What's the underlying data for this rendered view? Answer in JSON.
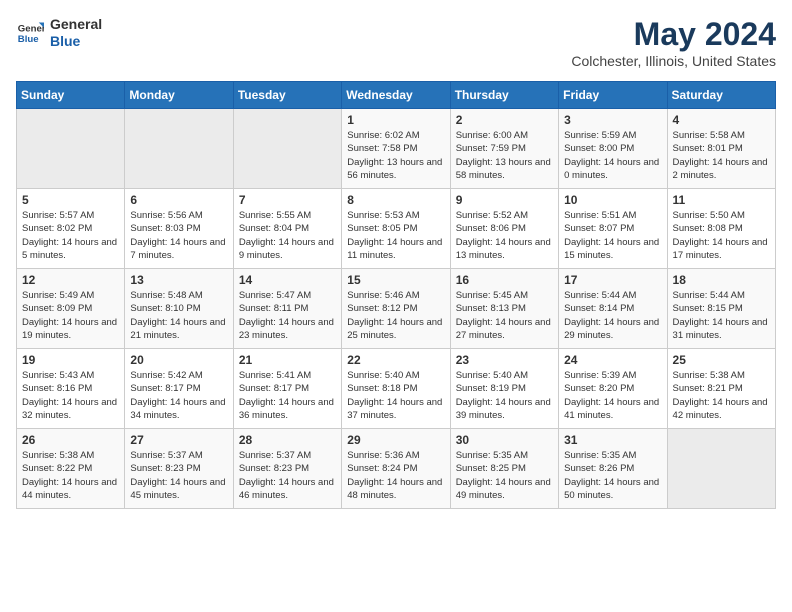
{
  "logo": {
    "general": "General",
    "blue": "Blue"
  },
  "header": {
    "month": "May 2024",
    "location": "Colchester, Illinois, United States"
  },
  "weekdays": [
    "Sunday",
    "Monday",
    "Tuesday",
    "Wednesday",
    "Thursday",
    "Friday",
    "Saturday"
  ],
  "weeks": [
    [
      {
        "day": "",
        "sunrise": "",
        "sunset": "",
        "daylight": ""
      },
      {
        "day": "",
        "sunrise": "",
        "sunset": "",
        "daylight": ""
      },
      {
        "day": "",
        "sunrise": "",
        "sunset": "",
        "daylight": ""
      },
      {
        "day": "1",
        "sunrise": "Sunrise: 6:02 AM",
        "sunset": "Sunset: 7:58 PM",
        "daylight": "Daylight: 13 hours and 56 minutes."
      },
      {
        "day": "2",
        "sunrise": "Sunrise: 6:00 AM",
        "sunset": "Sunset: 7:59 PM",
        "daylight": "Daylight: 13 hours and 58 minutes."
      },
      {
        "day": "3",
        "sunrise": "Sunrise: 5:59 AM",
        "sunset": "Sunset: 8:00 PM",
        "daylight": "Daylight: 14 hours and 0 minutes."
      },
      {
        "day": "4",
        "sunrise": "Sunrise: 5:58 AM",
        "sunset": "Sunset: 8:01 PM",
        "daylight": "Daylight: 14 hours and 2 minutes."
      }
    ],
    [
      {
        "day": "5",
        "sunrise": "Sunrise: 5:57 AM",
        "sunset": "Sunset: 8:02 PM",
        "daylight": "Daylight: 14 hours and 5 minutes."
      },
      {
        "day": "6",
        "sunrise": "Sunrise: 5:56 AM",
        "sunset": "Sunset: 8:03 PM",
        "daylight": "Daylight: 14 hours and 7 minutes."
      },
      {
        "day": "7",
        "sunrise": "Sunrise: 5:55 AM",
        "sunset": "Sunset: 8:04 PM",
        "daylight": "Daylight: 14 hours and 9 minutes."
      },
      {
        "day": "8",
        "sunrise": "Sunrise: 5:53 AM",
        "sunset": "Sunset: 8:05 PM",
        "daylight": "Daylight: 14 hours and 11 minutes."
      },
      {
        "day": "9",
        "sunrise": "Sunrise: 5:52 AM",
        "sunset": "Sunset: 8:06 PM",
        "daylight": "Daylight: 14 hours and 13 minutes."
      },
      {
        "day": "10",
        "sunrise": "Sunrise: 5:51 AM",
        "sunset": "Sunset: 8:07 PM",
        "daylight": "Daylight: 14 hours and 15 minutes."
      },
      {
        "day": "11",
        "sunrise": "Sunrise: 5:50 AM",
        "sunset": "Sunset: 8:08 PM",
        "daylight": "Daylight: 14 hours and 17 minutes."
      }
    ],
    [
      {
        "day": "12",
        "sunrise": "Sunrise: 5:49 AM",
        "sunset": "Sunset: 8:09 PM",
        "daylight": "Daylight: 14 hours and 19 minutes."
      },
      {
        "day": "13",
        "sunrise": "Sunrise: 5:48 AM",
        "sunset": "Sunset: 8:10 PM",
        "daylight": "Daylight: 14 hours and 21 minutes."
      },
      {
        "day": "14",
        "sunrise": "Sunrise: 5:47 AM",
        "sunset": "Sunset: 8:11 PM",
        "daylight": "Daylight: 14 hours and 23 minutes."
      },
      {
        "day": "15",
        "sunrise": "Sunrise: 5:46 AM",
        "sunset": "Sunset: 8:12 PM",
        "daylight": "Daylight: 14 hours and 25 minutes."
      },
      {
        "day": "16",
        "sunrise": "Sunrise: 5:45 AM",
        "sunset": "Sunset: 8:13 PM",
        "daylight": "Daylight: 14 hours and 27 minutes."
      },
      {
        "day": "17",
        "sunrise": "Sunrise: 5:44 AM",
        "sunset": "Sunset: 8:14 PM",
        "daylight": "Daylight: 14 hours and 29 minutes."
      },
      {
        "day": "18",
        "sunrise": "Sunrise: 5:44 AM",
        "sunset": "Sunset: 8:15 PM",
        "daylight": "Daylight: 14 hours and 31 minutes."
      }
    ],
    [
      {
        "day": "19",
        "sunrise": "Sunrise: 5:43 AM",
        "sunset": "Sunset: 8:16 PM",
        "daylight": "Daylight: 14 hours and 32 minutes."
      },
      {
        "day": "20",
        "sunrise": "Sunrise: 5:42 AM",
        "sunset": "Sunset: 8:17 PM",
        "daylight": "Daylight: 14 hours and 34 minutes."
      },
      {
        "day": "21",
        "sunrise": "Sunrise: 5:41 AM",
        "sunset": "Sunset: 8:17 PM",
        "daylight": "Daylight: 14 hours and 36 minutes."
      },
      {
        "day": "22",
        "sunrise": "Sunrise: 5:40 AM",
        "sunset": "Sunset: 8:18 PM",
        "daylight": "Daylight: 14 hours and 37 minutes."
      },
      {
        "day": "23",
        "sunrise": "Sunrise: 5:40 AM",
        "sunset": "Sunset: 8:19 PM",
        "daylight": "Daylight: 14 hours and 39 minutes."
      },
      {
        "day": "24",
        "sunrise": "Sunrise: 5:39 AM",
        "sunset": "Sunset: 8:20 PM",
        "daylight": "Daylight: 14 hours and 41 minutes."
      },
      {
        "day": "25",
        "sunrise": "Sunrise: 5:38 AM",
        "sunset": "Sunset: 8:21 PM",
        "daylight": "Daylight: 14 hours and 42 minutes."
      }
    ],
    [
      {
        "day": "26",
        "sunrise": "Sunrise: 5:38 AM",
        "sunset": "Sunset: 8:22 PM",
        "daylight": "Daylight: 14 hours and 44 minutes."
      },
      {
        "day": "27",
        "sunrise": "Sunrise: 5:37 AM",
        "sunset": "Sunset: 8:23 PM",
        "daylight": "Daylight: 14 hours and 45 minutes."
      },
      {
        "day": "28",
        "sunrise": "Sunrise: 5:37 AM",
        "sunset": "Sunset: 8:23 PM",
        "daylight": "Daylight: 14 hours and 46 minutes."
      },
      {
        "day": "29",
        "sunrise": "Sunrise: 5:36 AM",
        "sunset": "Sunset: 8:24 PM",
        "daylight": "Daylight: 14 hours and 48 minutes."
      },
      {
        "day": "30",
        "sunrise": "Sunrise: 5:35 AM",
        "sunset": "Sunset: 8:25 PM",
        "daylight": "Daylight: 14 hours and 49 minutes."
      },
      {
        "day": "31",
        "sunrise": "Sunrise: 5:35 AM",
        "sunset": "Sunset: 8:26 PM",
        "daylight": "Daylight: 14 hours and 50 minutes."
      },
      {
        "day": "",
        "sunrise": "",
        "sunset": "",
        "daylight": ""
      }
    ]
  ]
}
